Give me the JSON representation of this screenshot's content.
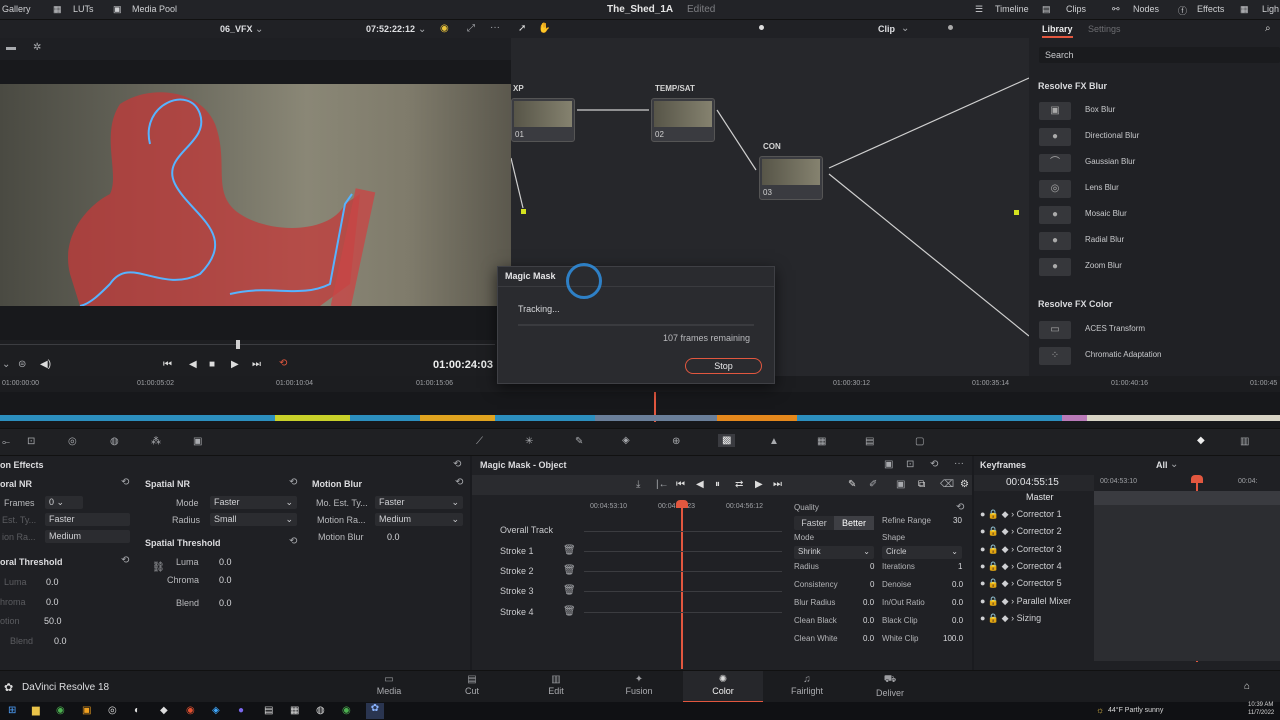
{
  "app": {
    "name": "DaVinci Resolve 18"
  },
  "topbar": {
    "gallery": "Gallery",
    "luts": "LUTs",
    "media_pool": "Media Pool",
    "project_title": "The_Shed_1A",
    "status": "Edited",
    "timeline": "Timeline",
    "clips": "Clips",
    "nodes": "Nodes",
    "effects": "Effects",
    "lightbox": "Ligh"
  },
  "viewer": {
    "timeline_name": "06_VFX",
    "source_timecode": "07:52:22:12",
    "record_timecode": "01:00:24:03"
  },
  "node_editor": {
    "mode": "Clip",
    "nodes": [
      {
        "label": "XP",
        "num": "01"
      },
      {
        "label": "TEMP/SAT",
        "num": "02"
      },
      {
        "label": "CON",
        "num": "03"
      }
    ]
  },
  "library": {
    "tab_library": "Library",
    "tab_settings": "Settings",
    "search_placeholder": "Search",
    "sections": [
      {
        "title": "Resolve FX Blur",
        "items": [
          "Box Blur",
          "Directional Blur",
          "Gaussian Blur",
          "Lens Blur",
          "Mosaic Blur",
          "Radial Blur",
          "Zoom Blur"
        ]
      },
      {
        "title": "Resolve FX Color",
        "items": [
          "ACES Transform",
          "Chromatic Adaptation"
        ]
      }
    ]
  },
  "dialog": {
    "title": "Magic Mask",
    "status": "Tracking...",
    "remaining": "107 frames remaining",
    "stop_label": "Stop"
  },
  "ruler": {
    "labels": [
      "01:00:00:00",
      "01:00:05:02",
      "01:00:10:04",
      "01:00:15:06",
      "01:00:30:12",
      "01:00:35:14",
      "01:00:40:16",
      "01:00:45"
    ]
  },
  "motion_effects": {
    "panel_title": "on Effects",
    "temporal_nr": "oral NR",
    "frames_label": "Frames",
    "frames_value": "0",
    "est_type_label": "Est. Ty...",
    "est_type_value": "Faster",
    "motion_range_label": "ion Ra...",
    "motion_range_value": "Medium",
    "temporal_threshold": "oral Threshold",
    "luma_label": "Luma",
    "luma_value": "0.0",
    "chroma_label": "hroma",
    "chroma_value": "0.0",
    "motion_label": "otion",
    "motion_value": "50.0",
    "blend_label": "Blend",
    "blend_value": "0.0",
    "spatial_nr": "Spatial NR",
    "mode_label": "Mode",
    "mode_value": "Faster",
    "radius_label": "Radius",
    "radius_value": "Small",
    "spatial_threshold": "Spatial Threshold",
    "s_luma_label": "Luma",
    "s_luma_value": "0.0",
    "s_chroma_label": "Chroma",
    "s_chroma_value": "0.0",
    "s_blend_label": "Blend",
    "s_blend_value": "0.0",
    "motion_blur": "Motion Blur",
    "mo_est_label": "Mo. Est. Ty...",
    "mo_est_value": "Faster",
    "mo_range_label": "Motion Ra...",
    "mo_range_value": "Medium",
    "mo_blur_label": "Motion Blur",
    "mo_blur_value": "0.0"
  },
  "magic_mask": {
    "title": "Magic Mask - Object",
    "times": [
      "00:04:53:10",
      "00:04:55:23",
      "00:04:56:12"
    ],
    "tracks": [
      "Overall Track",
      "Stroke 1",
      "Stroke 2",
      "Stroke 3",
      "Stroke 4"
    ],
    "quality_label": "Quality",
    "faster": "Faster",
    "better": "Better",
    "refine_range_label": "Refine Range",
    "refine_range_value": "30",
    "mode_label": "Mode",
    "mode_value": "Shrink",
    "shape_label": "Shape",
    "shape_value": "Circle",
    "radius_label": "Radius",
    "radius_value": "0",
    "iterations_label": "Iterations",
    "iterations_value": "1",
    "consistency_label": "Consistency",
    "consistency_value": "0",
    "denoise_label": "Denoise",
    "denoise_value": "0.0",
    "blur_radius_label": "Blur Radius",
    "blur_radius_value": "0.0",
    "inout_label": "In/Out Ratio",
    "inout_value": "0.0",
    "clean_black_label": "Clean Black",
    "clean_black_value": "0.0",
    "black_clip_label": "Black Clip",
    "black_clip_value": "0.0",
    "clean_white_label": "Clean White",
    "clean_white_value": "0.0",
    "white_clip_label": "White Clip",
    "white_clip_value": "100.0"
  },
  "keyframes": {
    "title": "Keyframes",
    "filter": "All",
    "timecode": "00:04:55:15",
    "ruler_a": "00:04:53:10",
    "ruler_b": "00:04:",
    "master": "Master",
    "rows": [
      "Corrector 1",
      "Corrector 2",
      "Corrector 3",
      "Corrector 4",
      "Corrector 5",
      "Parallel Mixer",
      "Sizing"
    ]
  },
  "pages": [
    "Media",
    "Cut",
    "Edit",
    "Fusion",
    "Color",
    "Fairlight",
    "Deliver"
  ],
  "taskbar": {
    "weather": "44°F  Partly sunny",
    "time": "10:39 AM",
    "date": "11/7/2022"
  },
  "colors": {
    "accent_red": "#e2573f",
    "accent_blue": "#2f8fe0",
    "mask_overlay": "#c33a3a"
  }
}
